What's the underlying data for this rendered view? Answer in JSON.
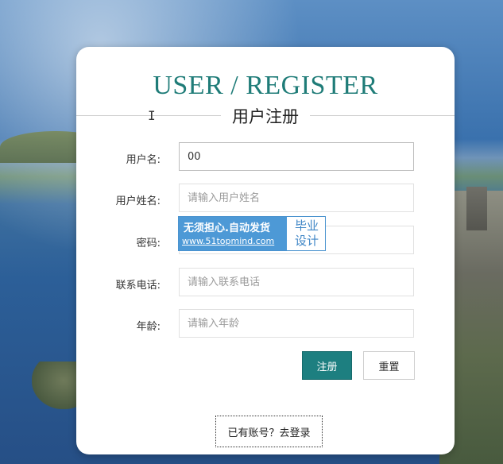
{
  "header": {
    "title_en": "USER / REGISTER",
    "title_cn": "用户注册"
  },
  "form": {
    "fields": [
      {
        "label": "用户名:",
        "value": "00",
        "placeholder": ""
      },
      {
        "label": "用户姓名:",
        "value": "",
        "placeholder": "请输入用户姓名"
      },
      {
        "label": "密码:",
        "value": "",
        "placeholder": ""
      },
      {
        "label": "联系电话:",
        "value": "",
        "placeholder": "请输入联系电话"
      },
      {
        "label": "年龄:",
        "value": "",
        "placeholder": "请输入年龄"
      }
    ],
    "register_label": "注册",
    "reset_label": "重置",
    "login_link": "已有账号？去登录"
  },
  "watermark": {
    "line1": "无须担心.自动发货",
    "line2": "www.51topmind.com",
    "badge_line1": "毕业",
    "badge_line2": "设计"
  },
  "colors": {
    "accent": "#1d7f80",
    "title": "#1f7c78",
    "watermark_blue": "#4d99d6"
  },
  "icons": {
    "cursor": "text-cursor-icon"
  }
}
